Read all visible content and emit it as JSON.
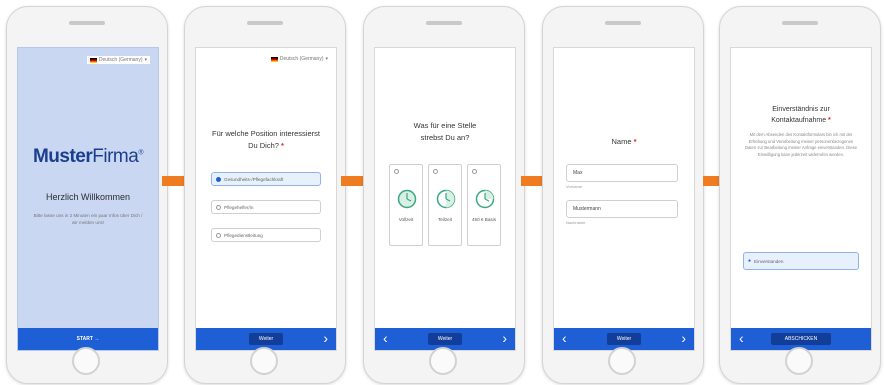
{
  "colors": {
    "brand_blue": "#1f5fd6",
    "brand_dark": "#123e99",
    "arrow_orange": "#f07c22",
    "welcome_bg": "#c9d7f2",
    "accent_red": "#e02020"
  },
  "language": {
    "label": "Deutsch (Germany)"
  },
  "screen1": {
    "brand_bold": "Muster",
    "brand_light": "Firma",
    "brand_mark": "®",
    "welcome": "Herzlich Willkommen",
    "subtitle": "Bitte lasse uns in 2 Minuten ein paar Infos über Dich / wir melden uns!",
    "start": "START →"
  },
  "screen2": {
    "question": "Für welche Position interessierst Du Dich?",
    "required": "*",
    "options": [
      "Gesundheits-/Pflegefachkraft",
      "Pflegehelfer/in",
      "Pflegedienstleitung"
    ],
    "button": "Weiter"
  },
  "screen3": {
    "question": "Was für eine Stelle strebst Du an?",
    "options": [
      "Vollzeit",
      "Teilzeit",
      "450 € Basis"
    ],
    "button": "Weiter"
  },
  "screen4": {
    "question": "Name",
    "required": "*",
    "first_value": "Max",
    "first_hint": "Vorname",
    "last_value": "Mustermann",
    "last_hint": "Nachname",
    "button": "Weiter"
  },
  "screen5": {
    "title": "Einverständnis zur Kontaktaufnahme",
    "required": "*",
    "text": "Mit dem Absenden des Kontaktformulars bin ich mit der Erhebung und Verarbeitung meiner personenbezogenen Daten zur Bearbeitung meiner Anfrage einverstanden. Diese Einwilligung kann jederzeit widerrufen werden.",
    "checkbox": "Einverstanden",
    "button": "ABSCHICKEN"
  },
  "nav": {
    "prev": "‹",
    "next": "›"
  }
}
